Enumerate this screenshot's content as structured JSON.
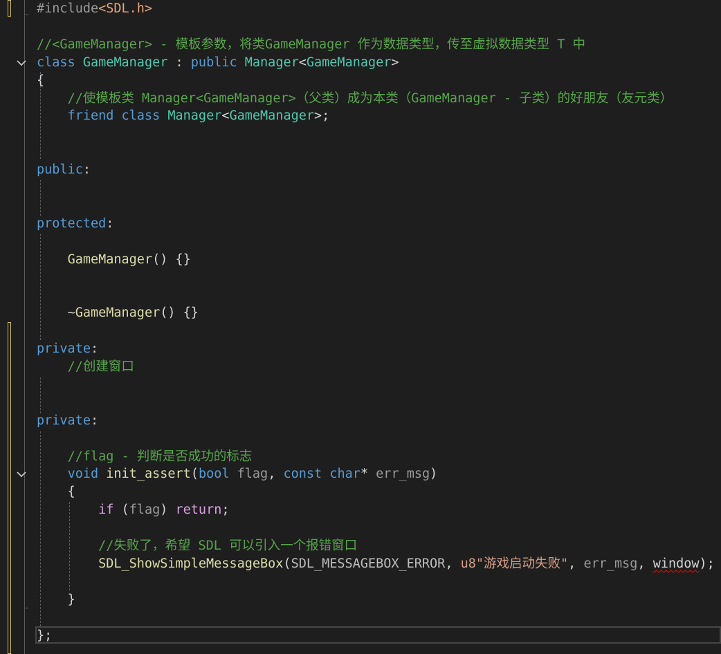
{
  "lines": [
    {
      "tokens": [
        {
          "t": "#include",
          "c": "dir"
        },
        {
          "t": "<SDL.h>",
          "c": "inc"
        }
      ]
    },
    {
      "tokens": []
    },
    {
      "tokens": [
        {
          "t": "//<GameManager> - 模板参数，将类GameManager 作为数据类型，传至虚拟数据类型 T 中",
          "c": "cmt"
        }
      ]
    },
    {
      "tokens": [
        {
          "t": "class",
          "c": "kw"
        },
        {
          "t": " ",
          "c": "txt"
        },
        {
          "t": "GameManager",
          "c": "cls"
        },
        {
          "t": " : ",
          "c": "txt"
        },
        {
          "t": "public",
          "c": "kw"
        },
        {
          "t": " ",
          "c": "txt"
        },
        {
          "t": "Manager",
          "c": "cls"
        },
        {
          "t": "<",
          "c": "txt"
        },
        {
          "t": "GameManager",
          "c": "cls"
        },
        {
          "t": ">",
          "c": "txt"
        }
      ]
    },
    {
      "tokens": [
        {
          "t": "{",
          "c": "txt"
        }
      ]
    },
    {
      "tokens": [
        {
          "t": "    ",
          "c": "txt"
        },
        {
          "t": "//使模板类 Manager<GameManager>（父类）成为本类（GameManager - 子类）的好朋友（友元类）",
          "c": "cmt"
        }
      ]
    },
    {
      "tokens": [
        {
          "t": "    ",
          "c": "txt"
        },
        {
          "t": "friend",
          "c": "kw"
        },
        {
          "t": " ",
          "c": "txt"
        },
        {
          "t": "class",
          "c": "kw"
        },
        {
          "t": " ",
          "c": "txt"
        },
        {
          "t": "Manager",
          "c": "cls"
        },
        {
          "t": "<",
          "c": "txt"
        },
        {
          "t": "GameManager",
          "c": "cls"
        },
        {
          "t": ">;",
          "c": "txt"
        }
      ]
    },
    {
      "tokens": []
    },
    {
      "tokens": []
    },
    {
      "tokens": [
        {
          "t": "public",
          "c": "kw"
        },
        {
          "t": ":",
          "c": "txt"
        }
      ]
    },
    {
      "tokens": []
    },
    {
      "tokens": []
    },
    {
      "tokens": [
        {
          "t": "protected",
          "c": "kw"
        },
        {
          "t": ":",
          "c": "txt"
        }
      ]
    },
    {
      "tokens": []
    },
    {
      "tokens": [
        {
          "t": "    ",
          "c": "txt"
        },
        {
          "t": "GameManager",
          "c": "fn"
        },
        {
          "t": "() {}",
          "c": "txt"
        }
      ]
    },
    {
      "tokens": []
    },
    {
      "tokens": []
    },
    {
      "tokens": [
        {
          "t": "    ",
          "c": "txt"
        },
        {
          "t": "~",
          "c": "txt"
        },
        {
          "t": "GameManager",
          "c": "fn"
        },
        {
          "t": "() {}",
          "c": "txt"
        }
      ]
    },
    {
      "tokens": []
    },
    {
      "tokens": [
        {
          "t": "private",
          "c": "kw"
        },
        {
          "t": ":",
          "c": "txt"
        }
      ]
    },
    {
      "tokens": [
        {
          "t": "    ",
          "c": "txt"
        },
        {
          "t": "//创建窗口",
          "c": "cmt"
        }
      ]
    },
    {
      "tokens": []
    },
    {
      "tokens": []
    },
    {
      "tokens": [
        {
          "t": "private",
          "c": "kw"
        },
        {
          "t": ":",
          "c": "txt"
        }
      ]
    },
    {
      "tokens": []
    },
    {
      "tokens": [
        {
          "t": "    ",
          "c": "txt"
        },
        {
          "t": "//flag - 判断是否成功的标志",
          "c": "cmt"
        }
      ]
    },
    {
      "tokens": [
        {
          "t": "    ",
          "c": "txt"
        },
        {
          "t": "void",
          "c": "kw"
        },
        {
          "t": " ",
          "c": "txt"
        },
        {
          "t": "init_assert",
          "c": "fn"
        },
        {
          "t": "(",
          "c": "txt"
        },
        {
          "t": "bool",
          "c": "kw"
        },
        {
          "t": " ",
          "c": "txt"
        },
        {
          "t": "flag",
          "c": "par"
        },
        {
          "t": ", ",
          "c": "txt"
        },
        {
          "t": "const",
          "c": "kw"
        },
        {
          "t": " ",
          "c": "txt"
        },
        {
          "t": "char",
          "c": "kw"
        },
        {
          "t": "* ",
          "c": "txt"
        },
        {
          "t": "err_msg",
          "c": "par"
        },
        {
          "t": ")",
          "c": "txt"
        }
      ]
    },
    {
      "tokens": [
        {
          "t": "    ",
          "c": "txt"
        },
        {
          "t": "{",
          "c": "txt"
        }
      ]
    },
    {
      "tokens": [
        {
          "t": "        ",
          "c": "txt"
        },
        {
          "t": "if",
          "c": "ctl"
        },
        {
          "t": " (",
          "c": "txt"
        },
        {
          "t": "flag",
          "c": "par"
        },
        {
          "t": ") ",
          "c": "txt"
        },
        {
          "t": "return",
          "c": "ctl"
        },
        {
          "t": ";",
          "c": "txt"
        }
      ]
    },
    {
      "tokens": []
    },
    {
      "tokens": [
        {
          "t": "        ",
          "c": "txt"
        },
        {
          "t": "//失败了，希望 SDL 可以引入一个报错窗口",
          "c": "cmt"
        }
      ]
    },
    {
      "tokens": [
        {
          "t": "        ",
          "c": "txt"
        },
        {
          "t": "SDL_ShowSimpleMessageBox",
          "c": "fn"
        },
        {
          "t": "(",
          "c": "txt"
        },
        {
          "t": "SDL_MESSAGEBOX_ERROR",
          "c": "enum"
        },
        {
          "t": ", ",
          "c": "txt"
        },
        {
          "t": "u8\"游戏启动失败\"",
          "c": "str"
        },
        {
          "t": ", ",
          "c": "txt"
        },
        {
          "t": "err_msg",
          "c": "par"
        },
        {
          "t": ", ",
          "c": "txt"
        },
        {
          "t": "window",
          "c": "txt",
          "squiggle": true
        },
        {
          "t": ");",
          "c": "txt"
        }
      ]
    },
    {
      "tokens": []
    },
    {
      "tokens": [
        {
          "t": "    ",
          "c": "txt"
        },
        {
          "t": "}",
          "c": "txt"
        }
      ]
    },
    {
      "tokens": []
    },
    {
      "tokens": [
        {
          "t": "};",
          "c": "txt"
        }
      ]
    }
  ],
  "fold_markers": [
    "class-fold-icon",
    "function-fold-icon"
  ],
  "colors": {
    "background": "#1e1e1e",
    "keyword": "#569cd6",
    "class": "#4ec9b0",
    "function": "#dcdcaa",
    "comment": "#57a64a",
    "string": "#d69d85",
    "control": "#d8a0df",
    "error_squiggle": "#e51400",
    "change_bar": "#d7c35a"
  }
}
